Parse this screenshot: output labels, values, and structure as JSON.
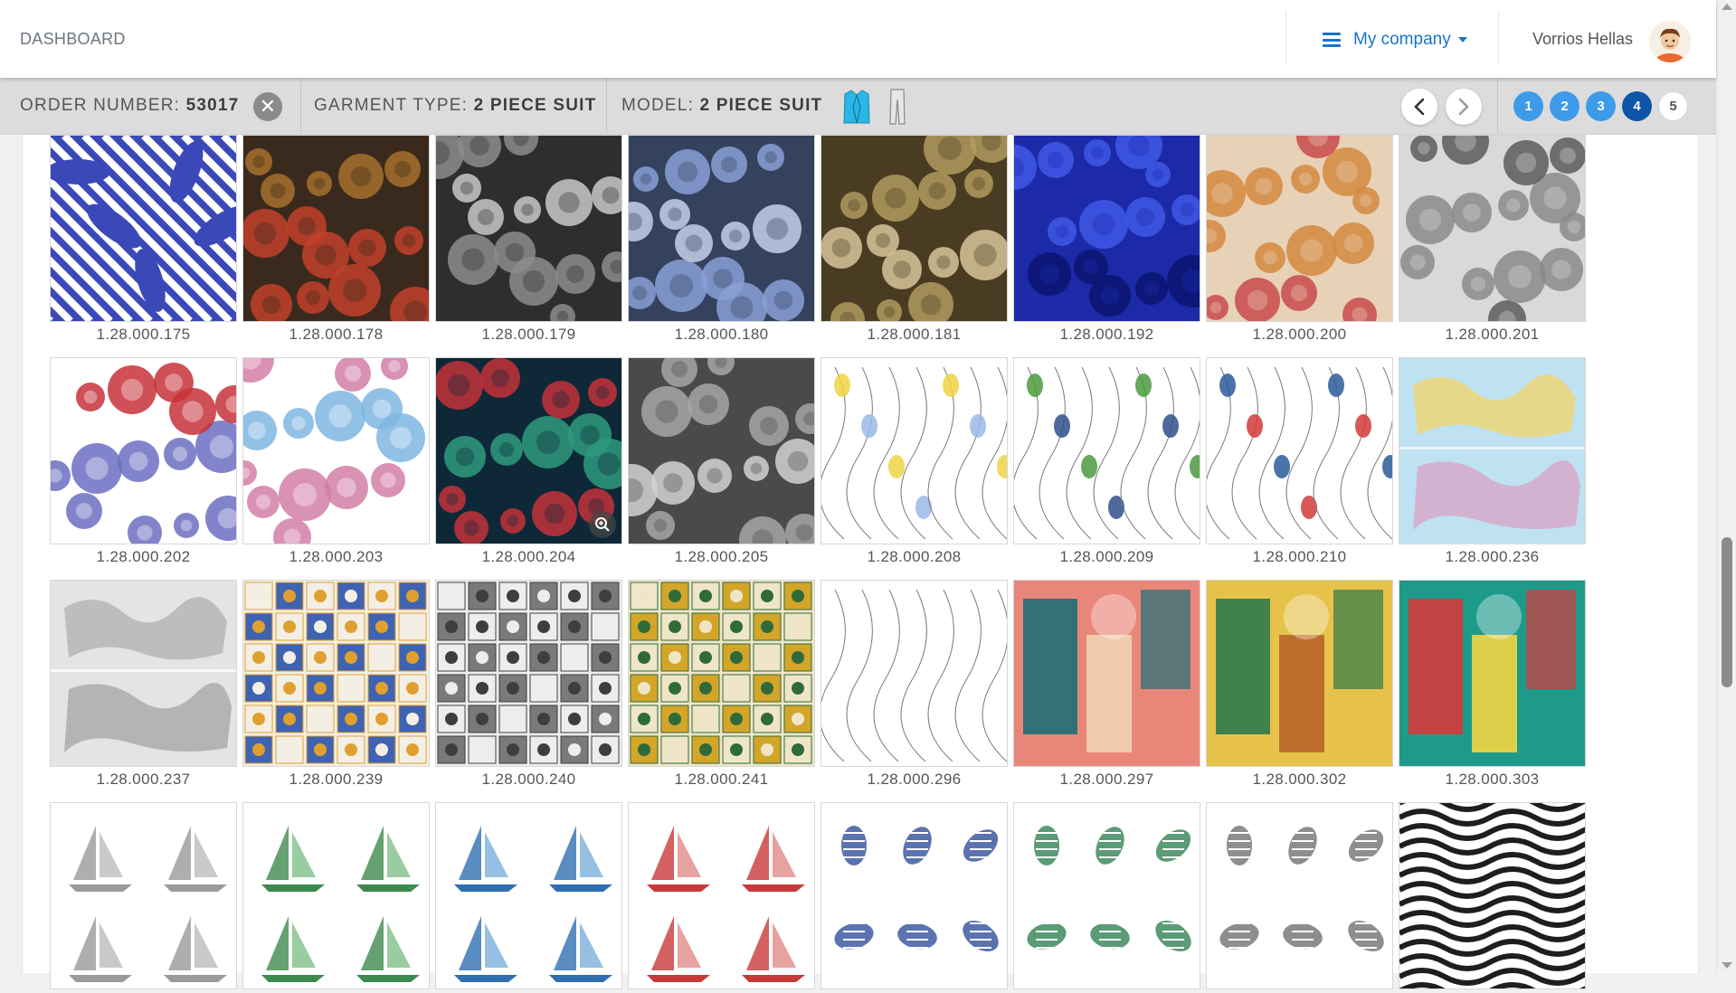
{
  "navbar": {
    "brand": "DASHBOARD",
    "company_label": "My company",
    "user_name": "Vorrios Hellas"
  },
  "order": {
    "order_label": "ORDER NUMBER:",
    "order_number": "53017",
    "garment_label": "GARMENT TYPE:",
    "garment_value": "2 PIECE SUIT",
    "model_label": "MODEL:",
    "model_value": "2 PIECE SUIT"
  },
  "steps": [
    {
      "label": "1",
      "state": "done"
    },
    {
      "label": "2",
      "state": "done"
    },
    {
      "label": "3",
      "state": "done"
    },
    {
      "label": "4",
      "state": "active"
    },
    {
      "label": "5",
      "state": "pending"
    }
  ],
  "colors": {
    "accent": "#1a73c8",
    "step_done": "#3d9be9",
    "step_active": "#0d55a8"
  },
  "fabrics": [
    {
      "code": "1.28.000.175",
      "bg": "#3b49b8",
      "fg": "#ffffff",
      "accent": "#2a2a2a",
      "motif": "stripes"
    },
    {
      "code": "1.28.000.178",
      "bg": "#3a2a1e",
      "fg": "#c2402a",
      "accent": "#a6702c",
      "motif": "blobs"
    },
    {
      "code": "1.28.000.179",
      "bg": "#2e2e2e",
      "fg": "#8c8c8c",
      "accent": "#c8c8c8",
      "motif": "blobs"
    },
    {
      "code": "1.28.000.180",
      "bg": "#34425e",
      "fg": "#8aa0d6",
      "accent": "#c5d0ea",
      "motif": "blobs"
    },
    {
      "code": "1.28.000.181",
      "bg": "#4a3c22",
      "fg": "#b09a5e",
      "accent": "#d7c69a",
      "motif": "blobs"
    },
    {
      "code": "1.28.000.192",
      "bg": "#1c2aa8",
      "fg": "#3e58e6",
      "accent": "#0b1470",
      "motif": "blobs"
    },
    {
      "code": "1.28.000.200",
      "bg": "#e7d2b8",
      "fg": "#d48a3e",
      "accent": "#c94a4a",
      "motif": "blobs"
    },
    {
      "code": "1.28.000.201",
      "bg": "#d9d9d9",
      "fg": "#8a8a8a",
      "accent": "#5a5a5a",
      "motif": "blobs"
    },
    {
      "code": "1.28.000.202",
      "bg": "#ffffff",
      "fg": "#6c6fc2",
      "accent": "#c8313a",
      "motif": "blobs"
    },
    {
      "code": "1.28.000.203",
      "bg": "#ffffff",
      "fg": "#d27ea7",
      "accent": "#7fb6e2",
      "motif": "blobs"
    },
    {
      "code": "1.28.000.204",
      "bg": "#0e2838",
      "fg": "#c2313a",
      "accent": "#2e9a7e",
      "motif": "blobs"
    },
    {
      "code": "1.28.000.205",
      "bg": "#4a4a4a",
      "fg": "#a6a6a6",
      "accent": "#d2d2d2",
      "motif": "blobs"
    },
    {
      "code": "1.28.000.208",
      "bg": "#ffffff",
      "fg": "#9ab8e6",
      "accent": "#f0d442",
      "motif": "lines"
    },
    {
      "code": "1.28.000.209",
      "bg": "#ffffff",
      "fg": "#2f4f8a",
      "accent": "#4b9a3e",
      "motif": "lines"
    },
    {
      "code": "1.28.000.210",
      "bg": "#ffffff",
      "fg": "#d23a3a",
      "accent": "#2d5a9a",
      "motif": "lines"
    },
    {
      "code": "1.28.000.236",
      "bg": "#bfe2f2",
      "fg": "#e6d88a",
      "accent": "#d8a6c8",
      "motif": "map"
    },
    {
      "code": "1.28.000.237",
      "bg": "#e4e4e4",
      "fg": "#bdbdbd",
      "accent": "#a8a8a8",
      "motif": "map"
    },
    {
      "code": "1.28.000.239",
      "bg": "#f3efe4",
      "fg": "#3f63b0",
      "accent": "#e0a030",
      "motif": "tiles"
    },
    {
      "code": "1.28.000.240",
      "bg": "#ededed",
      "fg": "#7a7a7a",
      "accent": "#3e3e3e",
      "motif": "tiles"
    },
    {
      "code": "1.28.000.241",
      "bg": "#efe6c8",
      "fg": "#d3a529",
      "accent": "#2f6b3a",
      "motif": "tiles"
    },
    {
      "code": "1.28.000.296",
      "bg": "#ffffff",
      "fg": "#9a9a9a",
      "accent": "#c8c8c8",
      "motif": "lines"
    },
    {
      "code": "1.28.000.297",
      "bg": "#e9867a",
      "fg": "#1e6f78",
      "accent": "#f0d2b0",
      "motif": "abstract"
    },
    {
      "code": "1.28.000.302",
      "bg": "#e6c24a",
      "fg": "#2f7a4a",
      "accent": "#b8652a",
      "motif": "abstract"
    },
    {
      "code": "1.28.000.303",
      "bg": "#1e9a8a",
      "fg": "#d43a3a",
      "accent": "#f3d542",
      "motif": "abstract"
    },
    {
      "code": "",
      "bg": "#ffffff",
      "fg": "#9a9a9a",
      "accent": "#bcbcbc",
      "motif": "boats"
    },
    {
      "code": "",
      "bg": "#ffffff",
      "fg": "#3e8a4e",
      "accent": "#7fbf8a",
      "motif": "boats"
    },
    {
      "code": "",
      "bg": "#ffffff",
      "fg": "#2f6fb0",
      "accent": "#7ab0dc",
      "motif": "boats"
    },
    {
      "code": "",
      "bg": "#ffffff",
      "fg": "#c83a3a",
      "accent": "#e08a8a",
      "motif": "boats"
    },
    {
      "code": "",
      "bg": "#ffffff",
      "fg": "#3e5aa0",
      "accent": "#8aa0d0",
      "motif": "shells"
    },
    {
      "code": "",
      "bg": "#ffffff",
      "fg": "#3e8a5e",
      "accent": "#8ac0a0",
      "motif": "shells"
    },
    {
      "code": "",
      "bg": "#ffffff",
      "fg": "#7a7a7a",
      "accent": "#b5b5b5",
      "motif": "shells"
    },
    {
      "code": "",
      "bg": "#ffffff",
      "fg": "#1e1e1e",
      "accent": "#1e1e1e",
      "motif": "waves"
    }
  ]
}
